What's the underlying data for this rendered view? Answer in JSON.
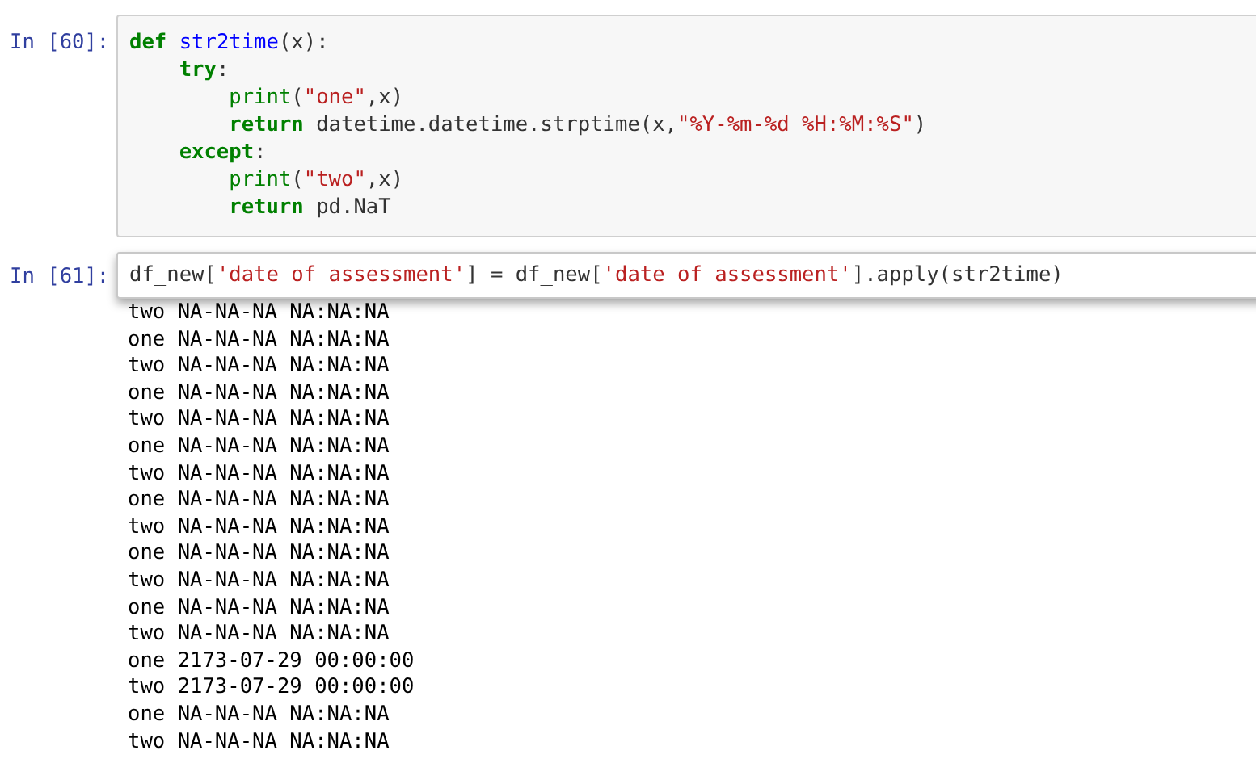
{
  "cells": [
    {
      "prompt": "In [60]:",
      "selected": false,
      "lines": [
        [
          {
            "text": "def ",
            "kind": "keyword"
          },
          {
            "text": "str2time",
            "kind": "function"
          },
          {
            "text": "(x):",
            "kind": "plain"
          }
        ],
        [
          {
            "text": "    try",
            "kind": "keyword"
          },
          {
            "text": ":",
            "kind": "plain"
          }
        ],
        [
          {
            "text": "        print",
            "kind": "builtin"
          },
          {
            "text": "(",
            "kind": "plain"
          },
          {
            "text": "\"one\"",
            "kind": "string"
          },
          {
            "text": ",x)",
            "kind": "plain"
          }
        ],
        [
          {
            "text": "        return",
            "kind": "keyword"
          },
          {
            "text": " datetime.datetime.strptime(x,",
            "kind": "plain"
          },
          {
            "text": "\"%Y-%m-%d %H:%M:%S\"",
            "kind": "string"
          },
          {
            "text": ")",
            "kind": "plain"
          }
        ],
        [
          {
            "text": "    except",
            "kind": "keyword"
          },
          {
            "text": ":",
            "kind": "plain"
          }
        ],
        [
          {
            "text": "        print",
            "kind": "builtin"
          },
          {
            "text": "(",
            "kind": "plain"
          },
          {
            "text": "\"two\"",
            "kind": "string"
          },
          {
            "text": ",x)",
            "kind": "plain"
          }
        ],
        [
          {
            "text": "        return",
            "kind": "keyword"
          },
          {
            "text": " pd.NaT",
            "kind": "plain"
          }
        ]
      ]
    },
    {
      "prompt": "In [61]:",
      "selected": true,
      "lines": [
        [
          {
            "text": "df_new[",
            "kind": "plain"
          },
          {
            "text": "'date of assessment'",
            "kind": "string"
          },
          {
            "text": "] = df_new[",
            "kind": "plain"
          },
          {
            "text": "'date of assessment'",
            "kind": "string"
          },
          {
            "text": "].apply(str2time)",
            "kind": "plain"
          }
        ]
      ],
      "output": [
        "two NA-NA-NA NA:NA:NA",
        "one NA-NA-NA NA:NA:NA",
        "two NA-NA-NA NA:NA:NA",
        "one NA-NA-NA NA:NA:NA",
        "two NA-NA-NA NA:NA:NA",
        "one NA-NA-NA NA:NA:NA",
        "two NA-NA-NA NA:NA:NA",
        "one NA-NA-NA NA:NA:NA",
        "two NA-NA-NA NA:NA:NA",
        "one NA-NA-NA NA:NA:NA",
        "two NA-NA-NA NA:NA:NA",
        "one NA-NA-NA NA:NA:NA",
        "two NA-NA-NA NA:NA:NA",
        "one 2173-07-29 00:00:00",
        "two 2173-07-29 00:00:00",
        "one NA-NA-NA NA:NA:NA",
        "two NA-NA-NA NA:NA:NA"
      ]
    }
  ]
}
